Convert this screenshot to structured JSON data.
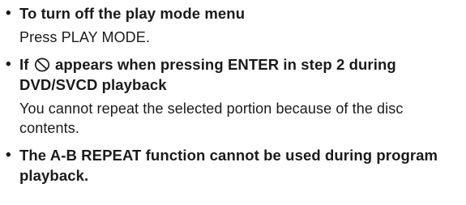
{
  "items": [
    {
      "heading": "To turn off the play mode menu",
      "body": "Press PLAY MODE."
    },
    {
      "heading_before_icon": "If",
      "icon": "prohibition-icon",
      "heading_after_icon": "appears when pressing ENTER in step 2 during DVD/SVCD playback",
      "body": "You cannot repeat the selected portion because of the disc contents."
    },
    {
      "heading": "The A-B REPEAT function cannot be used during program playback."
    }
  ]
}
